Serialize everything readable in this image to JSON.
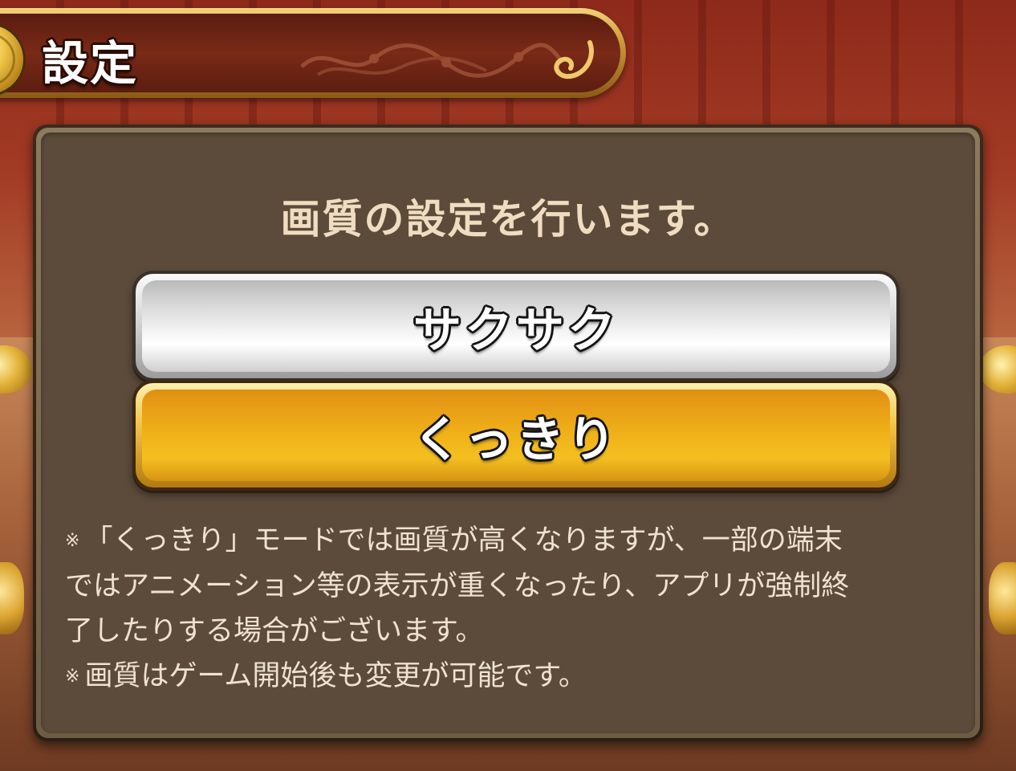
{
  "header": {
    "title": "設定"
  },
  "dialog": {
    "heading": "画質の設定を行います。",
    "options": [
      {
        "label": "サクサク",
        "style": "silver"
      },
      {
        "label": "くっきり",
        "style": "gold"
      }
    ],
    "notes": [
      {
        "mark": "※",
        "text": "「くっきり」モードでは画質が高くなりますが、一部の端末"
      },
      {
        "mark": "",
        "text": "ではアニメーション等の表示が重くなったり、アプリが強制終"
      },
      {
        "mark": "",
        "text": "了したりする場合がございます。"
      },
      {
        "mark": "※",
        "text": "画質はゲーム開始後も変更が可能です。"
      }
    ]
  },
  "colors": {
    "silver_button": "#d9d9d9",
    "gold_button": "#f1b51b",
    "dialog_bg": "#5c4b3b",
    "text": "#f0dcc0"
  }
}
